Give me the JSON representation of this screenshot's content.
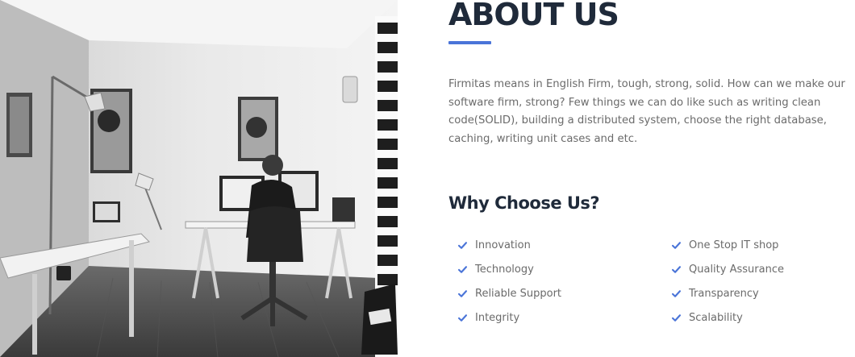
{
  "about": {
    "title": "ABOUT US",
    "description": "Firmitas means in English Firm, tough, strong, solid. How can we make our software firm, strong? Few things we can do like such as writing clean code(SOLID), building a distributed system, choose the right database, caching, writing unit cases and etc."
  },
  "why": {
    "title": "Why Choose Us?",
    "left_items": [
      {
        "label": "Innovation",
        "icon": "check-icon"
      },
      {
        "label": "Technology",
        "icon": "check-icon"
      },
      {
        "label": "Reliable Support",
        "icon": "check-icon"
      },
      {
        "label": "Integrity",
        "icon": "check-icon"
      }
    ],
    "right_items": [
      {
        "label": "One Stop IT shop",
        "icon": "check-icon"
      },
      {
        "label": "Quality Assurance",
        "icon": "check-icon"
      },
      {
        "label": "Transparency",
        "icon": "check-icon"
      },
      {
        "label": "Scalability",
        "icon": "check-icon"
      }
    ]
  },
  "colors": {
    "accent": "#4a74d8",
    "check": "#4a74d8",
    "heading": "#1f2a3a",
    "body_text": "#6b6b6b"
  }
}
